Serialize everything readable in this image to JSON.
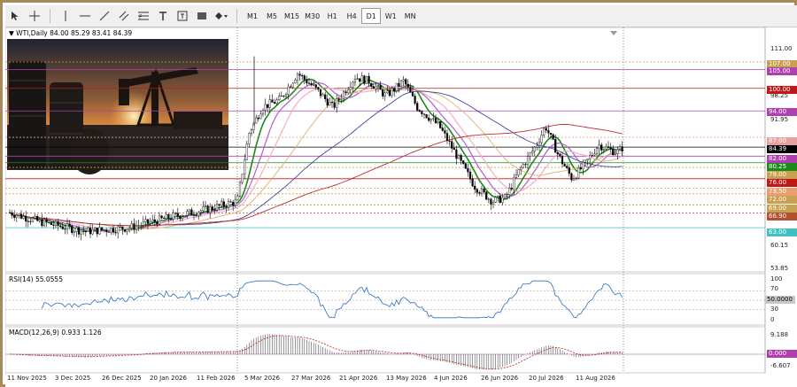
{
  "toolbar": {
    "timeframes": [
      "M1",
      "M5",
      "M15",
      "M30",
      "H1",
      "H4",
      "D1",
      "W1",
      "MN"
    ],
    "active_timeframe": "D1"
  },
  "main": {
    "title": "WTI,Daily",
    "ohlc": "84.00 85.29 83.41 84.39",
    "axis": [
      "111.00",
      "98.25",
      "91.95",
      "73.50",
      "66.90",
      "60.15",
      "53.85"
    ],
    "price_labels": [
      {
        "text": "107.00",
        "color": "#c8a050"
      },
      {
        "text": "105.00",
        "color": "#b040b0"
      },
      {
        "text": "100.00",
        "color": "#c01818"
      },
      {
        "text": "94.00",
        "color": "#b040b0"
      },
      {
        "text": "87.00",
        "color": "#e8a0a0"
      },
      {
        "text": "84.39",
        "color": "#000000"
      },
      {
        "text": "82.00",
        "color": "#b040b0"
      },
      {
        "text": "80.25",
        "color": "#1a8a1a"
      },
      {
        "text": "79.00",
        "color": "#c8a050"
      },
      {
        "text": "76.00",
        "color": "#c01818"
      },
      {
        "text": "73.50",
        "color": "#e8a070"
      },
      {
        "text": "72.00",
        "color": "#c8a050"
      },
      {
        "text": "69.00",
        "color": "#c8a050"
      },
      {
        "text": "66.90",
        "color": "#b05030"
      },
      {
        "text": "63.00",
        "color": "#40c0c0"
      }
    ]
  },
  "rsi": {
    "title": "RSI(14) 55.0555",
    "axis": [
      "100",
      "70",
      "30",
      "0"
    ],
    "level_label": "50.0000"
  },
  "macd": {
    "title": "MACD(12,26,9) 0.933 1.126",
    "axis": [
      "9.188",
      "-6.607"
    ],
    "zero_label": "0.000"
  },
  "dates": [
    "11 Nov 2025",
    "3 Dec 2025",
    "26 Dec 2025",
    "20 Jan 2026",
    "11 Feb 2026",
    "5 Mar 2026",
    "27 Mar 2026",
    "21 Apr 2026",
    "13 May 2026",
    "4 Jun 2026",
    "26 Jun 2026",
    "20 Jul 2026",
    "11 Aug 2026"
  ],
  "colors": {
    "frame": "#a9895a",
    "ma_green": "#1a8a1a",
    "ma_violet": "#b060d0",
    "ma_pink": "#f0b0c0",
    "ma_navy": "#3a4a9a",
    "ma_red": "#c03030",
    "ma_tan": "#e0b070"
  }
}
